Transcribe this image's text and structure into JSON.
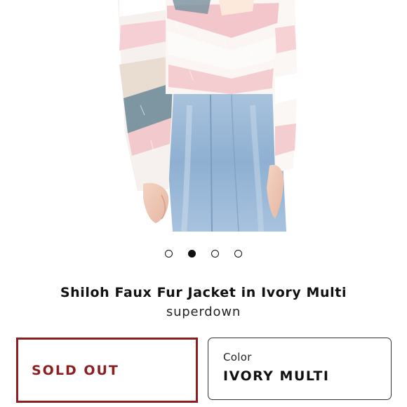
{
  "product": {
    "title": "Shiloh Faux Fur Jacket in Ivory Multi",
    "brand": "superdown",
    "image_alt_icon": "product-photo"
  },
  "carousel": {
    "dots": [
      "slide-1",
      "slide-2",
      "slide-3",
      "slide-4"
    ],
    "active_index": 1
  },
  "purchase": {
    "status_label": "SOLD OUT",
    "status_color": "#8b1e1e"
  },
  "color": {
    "label": "Color",
    "value": "IVORY MULTI"
  }
}
